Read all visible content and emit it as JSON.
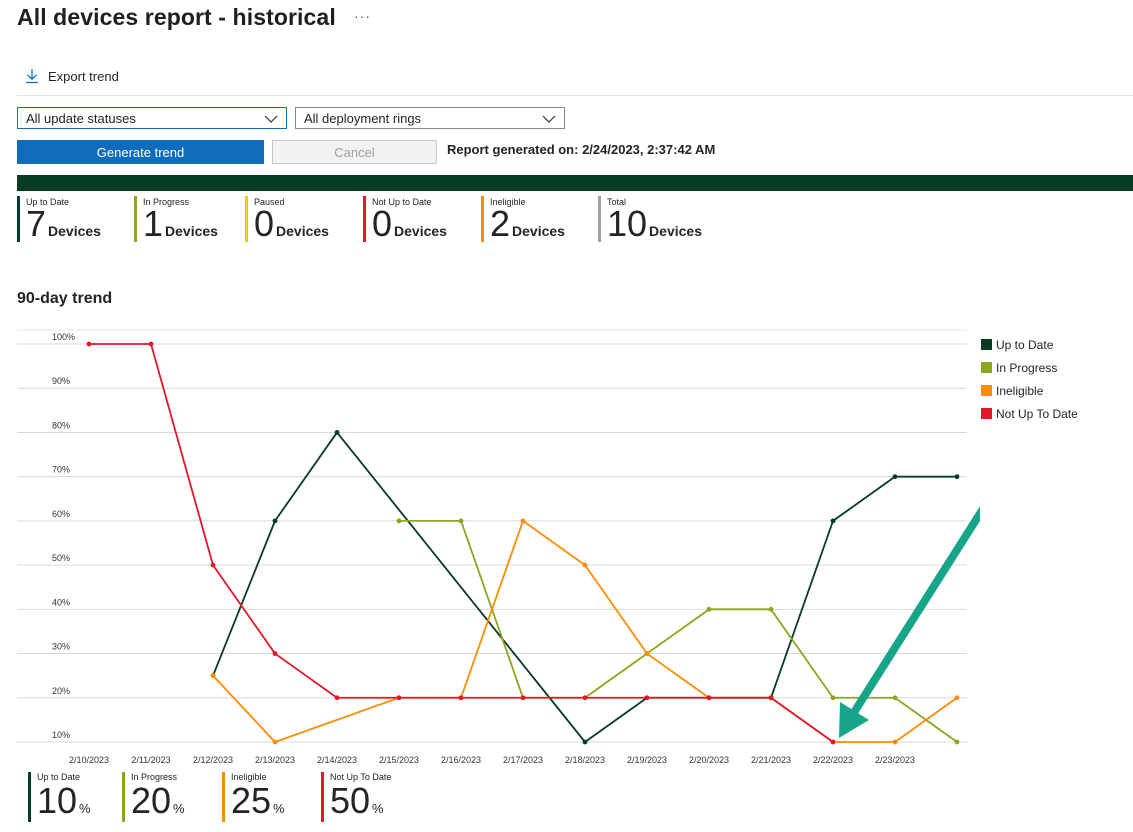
{
  "page": {
    "title": "All devices report - historical",
    "more_label": "···"
  },
  "toolbar": {
    "export_label": "Export trend"
  },
  "filters": {
    "status_select": "All update statuses",
    "rings_select": "All deployment rings"
  },
  "actions": {
    "generate_label": "Generate trend",
    "cancel_label": "Cancel",
    "report_generated": "Report generated on: 2/24/2023, 2:37:42 AM"
  },
  "summary": [
    {
      "label": "Up to Date",
      "value": "7",
      "unit": "Devices",
      "color": "#063b24"
    },
    {
      "label": "In Progress",
      "value": "1",
      "unit": "Devices",
      "color": "#8aa51e"
    },
    {
      "label": "Paused",
      "value": "0",
      "unit": "Devices",
      "color": "#f2c80f"
    },
    {
      "label": "Not Up to Date",
      "value": "0",
      "unit": "Devices",
      "color": "#e3162a"
    },
    {
      "label": "Ineligible",
      "value": "2",
      "unit": "Devices",
      "color": "#ff8c00"
    },
    {
      "label": "Total",
      "value": "10",
      "unit": "Devices",
      "color": "#a0a0a0"
    }
  ],
  "trend": {
    "heading": "90-day trend"
  },
  "legend": [
    {
      "label": "Up to Date",
      "color": "#063b24"
    },
    {
      "label": "In Progress",
      "color": "#8aa51e"
    },
    {
      "label": "Ineligible",
      "color": "#ff8c00"
    },
    {
      "label": "Not Up To Date",
      "color": "#e3162a"
    }
  ],
  "chart_data": {
    "type": "line",
    "categories": [
      "2/10/2023",
      "2/11/2023",
      "2/12/2023",
      "2/13/2023",
      "2/14/2023",
      "2/15/2023",
      "2/16/2023",
      "2/17/2023",
      "2/18/2023",
      "2/19/2023",
      "2/20/2023",
      "2/21/2023",
      "2/22/2023",
      "2/23/2023",
      ""
    ],
    "yticks": [
      "100%",
      "90%",
      "80%",
      "70%",
      "60%",
      "50%",
      "40%",
      "30%",
      "20%",
      "10%"
    ],
    "ylim": [
      10,
      100
    ],
    "series": [
      {
        "name": "Up to Date",
        "color": "#063b24",
        "points": [
          [
            2,
            25
          ],
          [
            3,
            60
          ],
          [
            4,
            80
          ],
          [
            8,
            10
          ],
          [
            9,
            20
          ],
          [
            10,
            20
          ],
          [
            11,
            20
          ],
          [
            12,
            60
          ],
          [
            13,
            70
          ],
          [
            14,
            70
          ]
        ]
      },
      {
        "name": "In Progress",
        "color": "#8aa51e",
        "points": [
          [
            5,
            60
          ],
          [
            6,
            60
          ],
          [
            7,
            20
          ],
          [
            8,
            20
          ],
          [
            9,
            30
          ],
          [
            10,
            40
          ],
          [
            11,
            40
          ],
          [
            12,
            20
          ],
          [
            13,
            20
          ],
          [
            14,
            10
          ]
        ]
      },
      {
        "name": "Ineligible",
        "color": "#ff8c00",
        "points": [
          [
            2,
            25
          ],
          [
            3,
            10
          ],
          [
            5,
            20
          ],
          [
            6,
            20
          ],
          [
            7,
            60
          ],
          [
            8,
            50
          ],
          [
            9,
            30
          ],
          [
            10,
            20
          ],
          [
            11,
            20
          ],
          [
            12,
            10
          ],
          [
            13,
            10
          ],
          [
            14,
            20
          ]
        ]
      },
      {
        "name": "Not Up To Date",
        "color": "#e3162a",
        "points": [
          [
            0,
            100
          ],
          [
            1,
            100
          ],
          [
            2,
            50
          ],
          [
            3,
            30
          ],
          [
            4,
            20
          ],
          [
            5,
            20
          ],
          [
            6,
            20
          ],
          [
            7,
            20
          ],
          [
            8,
            20
          ],
          [
            9,
            20
          ],
          [
            10,
            20
          ],
          [
            11,
            20
          ],
          [
            12,
            10
          ]
        ]
      }
    ],
    "annotation": {
      "type": "arrow",
      "color": "#17a589",
      "target_index": 12,
      "target_value": 10
    }
  },
  "percent_summary": [
    {
      "label": "Up to Date",
      "value": "10",
      "unit": "%",
      "color": "#063b24"
    },
    {
      "label": "In Progress",
      "value": "20",
      "unit": "%",
      "color": "#8aa51e"
    },
    {
      "label": "Ineligible",
      "value": "25",
      "unit": "%",
      "color": "#ff8c00"
    },
    {
      "label": "Not Up To Date",
      "value": "50",
      "unit": "%",
      "color": "#e3162a"
    }
  ]
}
